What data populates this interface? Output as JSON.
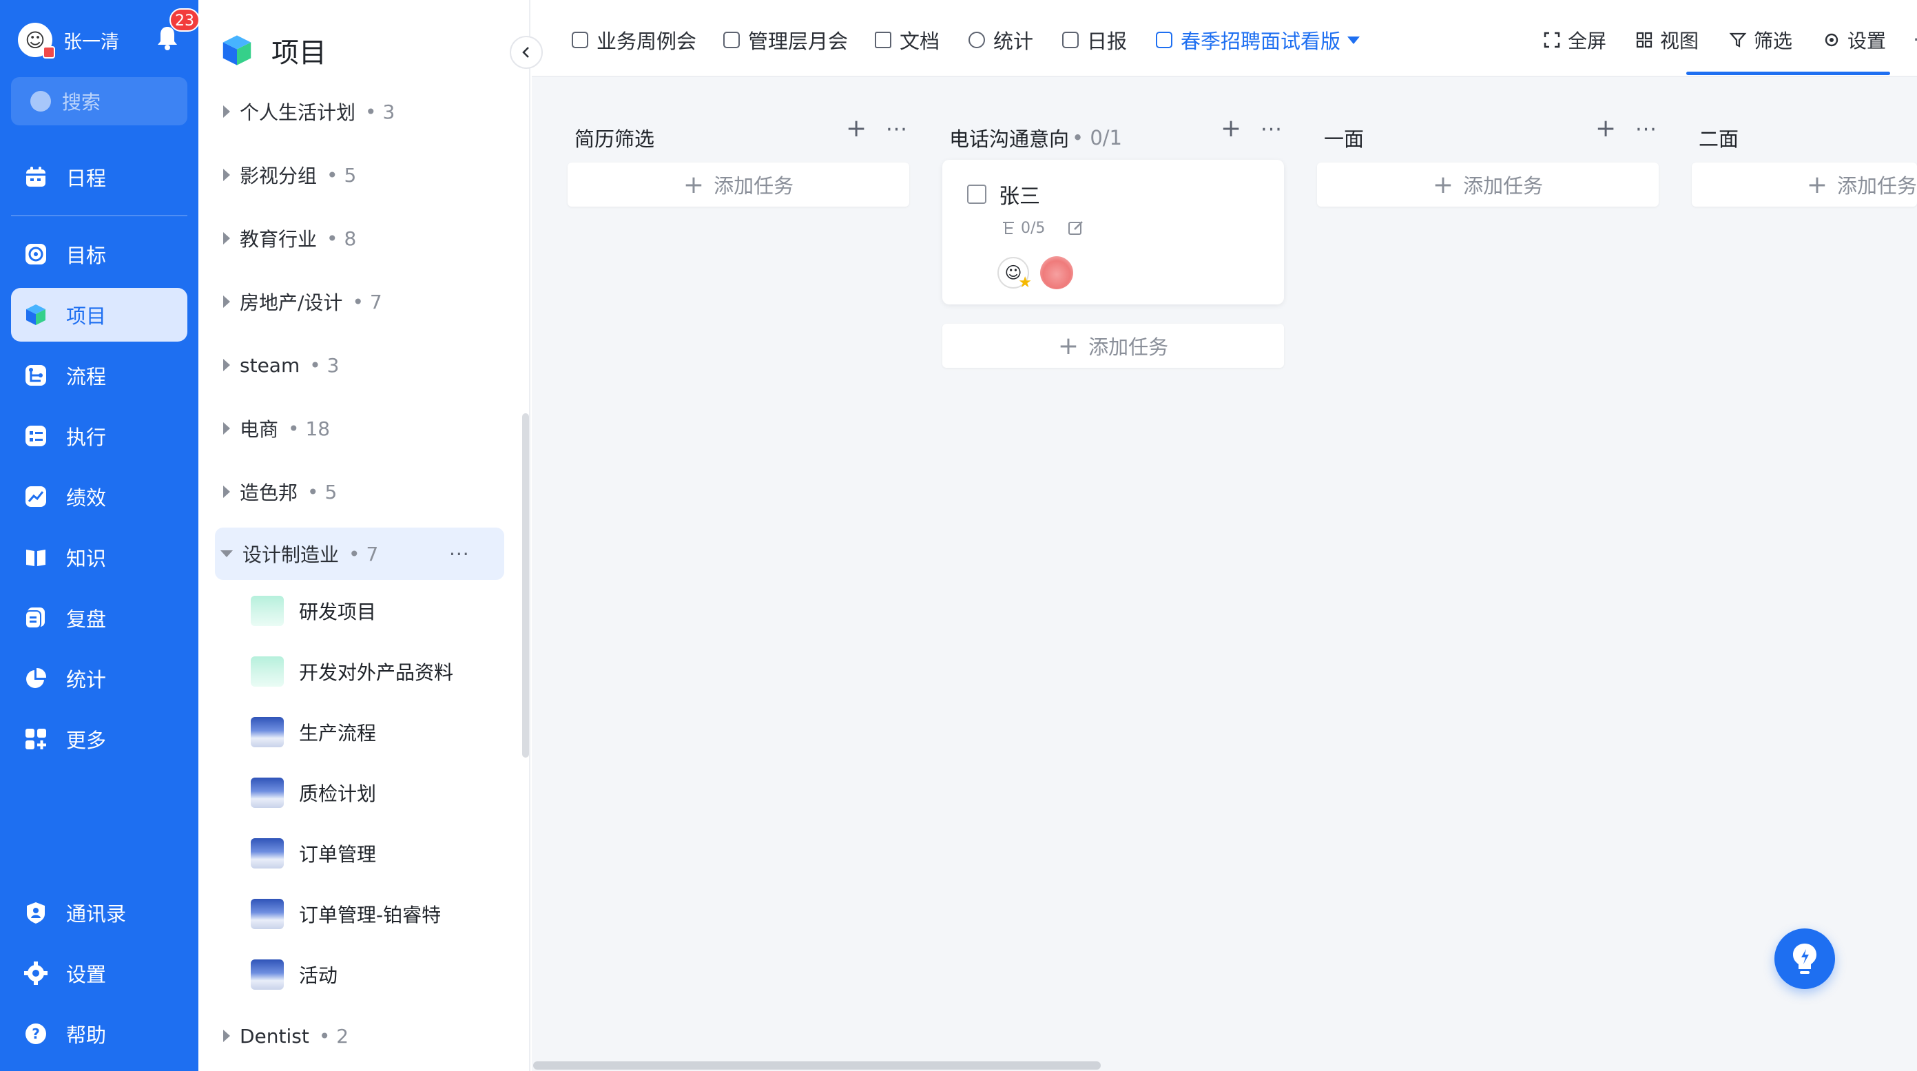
{
  "nav": {
    "user_name": "张一清",
    "notification_count": "23",
    "search_placeholder": "搜索",
    "items": [
      {
        "label": "日程",
        "icon": "calendar-icon"
      },
      {
        "label": "目标",
        "icon": "target-icon"
      },
      {
        "label": "项目",
        "icon": "cube-icon",
        "active": true
      },
      {
        "label": "流程",
        "icon": "flow-icon"
      },
      {
        "label": "执行",
        "icon": "checklist-icon"
      },
      {
        "label": "绩效",
        "icon": "chart-icon"
      },
      {
        "label": "知识",
        "icon": "book-icon"
      },
      {
        "label": "复盘",
        "icon": "review-icon"
      },
      {
        "label": "统计",
        "icon": "pie-icon"
      },
      {
        "label": "更多",
        "icon": "apps-icon"
      }
    ],
    "bottom_items": [
      {
        "label": "通讯录",
        "icon": "contacts-icon"
      },
      {
        "label": "设置",
        "icon": "gear-icon"
      },
      {
        "label": "帮助",
        "icon": "help-icon"
      }
    ]
  },
  "panel": {
    "title": "项目",
    "groups": [
      {
        "name": "个人生活计划",
        "count": "3"
      },
      {
        "name": "影视分组",
        "count": "5"
      },
      {
        "name": "教育行业",
        "count": "8"
      },
      {
        "name": "房地产/设计",
        "count": "7"
      },
      {
        "name": "steam",
        "count": "3"
      },
      {
        "name": "电商",
        "count": "18"
      },
      {
        "name": "造色邦",
        "count": "5"
      },
      {
        "name": "设计制造业",
        "count": "7",
        "open": true
      },
      {
        "name": "Dentist",
        "count": "2"
      }
    ],
    "group_more": "···",
    "projects": [
      {
        "name": "研发项目",
        "thumb": "green"
      },
      {
        "name": "开发对外产品资料",
        "thumb": "green"
      },
      {
        "name": "生产流程",
        "thumb": "blue"
      },
      {
        "name": "质检计划",
        "thumb": "blue"
      },
      {
        "name": "订单管理",
        "thumb": "blue"
      },
      {
        "name": "订单管理-铂睿特",
        "thumb": "blue"
      },
      {
        "name": "活动",
        "thumb": "blue"
      }
    ]
  },
  "tabs": [
    {
      "label": "业务周例会"
    },
    {
      "label": "管理层月会"
    },
    {
      "label": "文档"
    },
    {
      "label": "统计"
    },
    {
      "label": "日报"
    },
    {
      "label": "春季招聘面试看版",
      "active": true
    }
  ],
  "tab_add": "+",
  "tools": [
    {
      "label": "全屏",
      "icon": "fullscreen-icon"
    },
    {
      "label": "视图",
      "icon": "grid-icon"
    },
    {
      "label": "筛选",
      "icon": "filter-icon"
    },
    {
      "label": "设置",
      "icon": "gear-icon"
    }
  ],
  "board": {
    "columns": [
      {
        "title": "简历筛选",
        "progress": ""
      },
      {
        "title": "电话沟通意向",
        "progress": "• 0/1"
      },
      {
        "title": "一面",
        "progress": ""
      },
      {
        "title": "二面",
        "progress": ""
      }
    ],
    "add_task_label": "添加任务",
    "card": {
      "title": "张三",
      "subtasks": "0/5"
    }
  },
  "colors": {
    "brand": "#1e6ff1",
    "highlight_box": "#e8262c",
    "badge": "#f23c3c"
  }
}
